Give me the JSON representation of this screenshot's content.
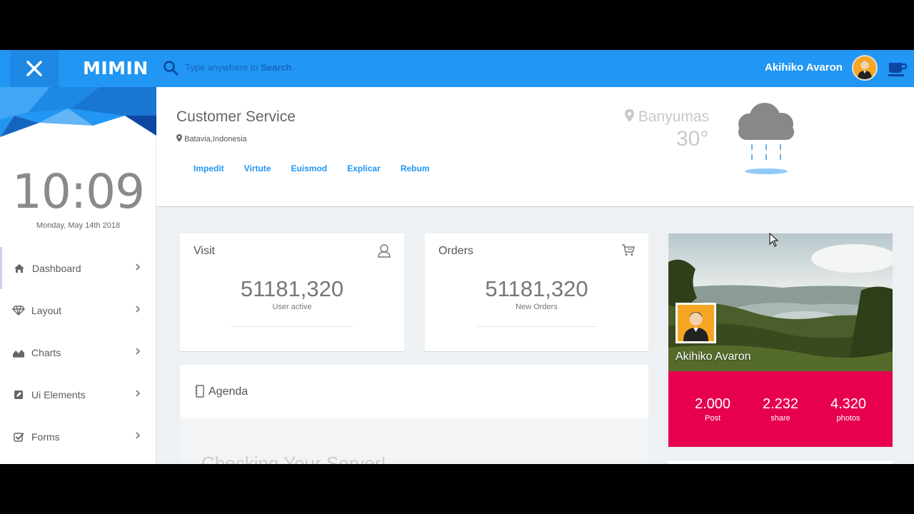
{
  "app": {
    "brand": "MIMIN"
  },
  "search": {
    "placeholder_prefix": "Type anywhere to",
    "placeholder_bold": "Search"
  },
  "user": {
    "name": "Akihiko Avaron"
  },
  "sidebar": {
    "time": "10:09",
    "date": "Monday, May 14th 2018",
    "items": [
      {
        "label": "Dashboard",
        "icon": "home-icon"
      },
      {
        "label": "Layout",
        "icon": "diamond-icon"
      },
      {
        "label": "Charts",
        "icon": "area-chart-icon"
      },
      {
        "label": "Ui Elements",
        "icon": "pencil-square-icon"
      },
      {
        "label": "Forms",
        "icon": "check-square-icon"
      }
    ]
  },
  "header": {
    "title": "Customer Service",
    "location": "Batavia,Indonesia",
    "links": [
      "Impedit",
      "Virtute",
      "Euismod",
      "Explicar",
      "Rebum"
    ],
    "weather": {
      "city": "Banyumas",
      "temp": "30°",
      "icon": "rain-cloud-icon"
    }
  },
  "cards": {
    "visit": {
      "title": "Visit",
      "value": "51181,320",
      "sub": "User active",
      "icon": "user-icon"
    },
    "orders": {
      "title": "Orders",
      "value": "51181,320",
      "sub": "New Orders",
      "icon": "cart-icon"
    }
  },
  "agenda": {
    "title": "Agenda",
    "heading": "Checking Your Server!"
  },
  "profile": {
    "name": "Akihiko Avaron",
    "stats": [
      {
        "value": "2.000",
        "label": "Post"
      },
      {
        "value": "2.232",
        "label": "share"
      },
      {
        "value": "4.320",
        "label": "photos"
      }
    ]
  },
  "colors": {
    "topbar": "#2196f3",
    "accent_pink": "#e6004f",
    "link": "#2196f3"
  }
}
